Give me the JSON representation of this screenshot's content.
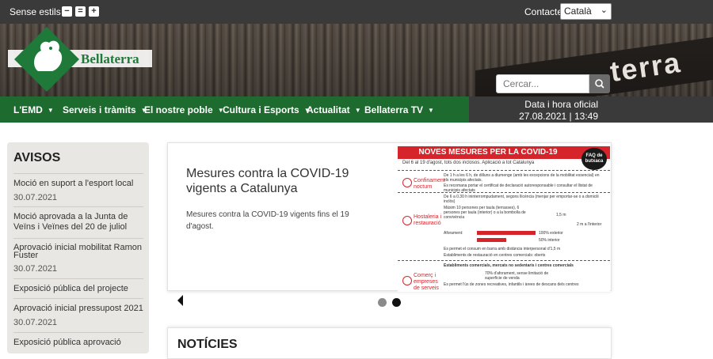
{
  "topbar": {
    "styles_label": "Sense estils",
    "zoom_out": "−",
    "zoom_reset": "=",
    "zoom_in": "+",
    "contact_label": "Contacte",
    "language": "Català"
  },
  "header": {
    "logo_text": "Bellaterra",
    "search_placeholder": "Cercar...",
    "banner_sign_text": "terra"
  },
  "nav": {
    "items": [
      "L'EMD",
      "Serveis i tràmits",
      "El nostre poble",
      "Cultura i Esports",
      "Actualitat",
      "Bellaterra TV"
    ],
    "date_label": "Data i hora oficial",
    "date_value": "27.08.2021 | 13:49"
  },
  "avisos": {
    "title": "AVISOS",
    "items": [
      {
        "text": "Moció en suport a l'esport local",
        "date": "30.07.2021"
      },
      {
        "text": "Moció aprovada a la Junta de Veïns i Veïnes del 20 de juliol",
        "date": ""
      },
      {
        "text": "Aprovació inicial mobilitat Ramon Fuster",
        "date": "30.07.2021"
      },
      {
        "text": "Exposició pública del projecte",
        "date": ""
      },
      {
        "text": "Aprovació inicial pressupost 2021",
        "date": "30.07.2021"
      },
      {
        "text": "Exposició pública aprovació",
        "date": ""
      }
    ]
  },
  "slide": {
    "title": "Mesures contra la COVID-19 vigents a Catalunya",
    "text": "Mesures contra la COVID-19 vigents fins el 19 d'agost.",
    "infographic": {
      "title": "NOVES MESURES PER LA COVID-19",
      "faq": "FAQ de butxaca",
      "subtitle": "Del 6 al 19 d'agost, tots dos inclosos. Aplicació a tot Catalunya",
      "sec1": "Confinament nocturn",
      "sec1_text1": "De 1 h a les 6 h, de dilluns a diumenge (amb les excepcions de la mobilitat essencial) en els municipis afectats.",
      "sec1_text2": "Es recomana portar el certificat de declaració autoresponsable i consultar el llistat de municipis afectats",
      "sec2": "Hostaleria i restauració",
      "sec2_text1": "De 6 a 0.30 h ininterrompudament, segons llicència (menjar per emportar-se o a domicili inclòs)",
      "sec2_text2": "Màxim 10 persones per taula (terrasses), 6 persones per taula (interior) o a la bombolla de convivència",
      "distance1": "1,5 m",
      "distance2": "2 m a l'interior",
      "aforament_label": "Aforament:",
      "bar1_label": "100% exterior",
      "bar1_value": 100,
      "bar2_label": "50% interior",
      "bar2_value": 50,
      "sec2_text3": "Es permet el consum en barra amb distància interpersonal d'1,5 m",
      "sec2_text4": "Establiments de restauració en centres comercials: oberts",
      "sec3_head": "Establiments comercials, mercats no sedentaris i centres comercials",
      "sec3": "Comerç i empreses de serveis",
      "sec3_text1": "70% d'aforament, sense limitació de superfície de venda",
      "sec3_text2": "Es permet l'ús de zones recreatives, infantils i àrees de descans dels centres"
    }
  },
  "noticies": {
    "title": "NOTÍCIES"
  },
  "colors": {
    "nav_green": "#1d6b2f",
    "covid_red": "#d6242b",
    "topbar": "#3a3a3a"
  }
}
